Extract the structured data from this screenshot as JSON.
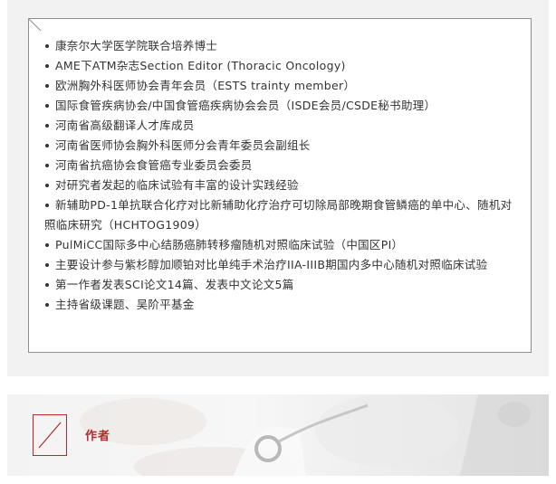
{
  "bio": {
    "items": [
      "康奈尔大学医学院联合培养博士",
      "AME下ATM杂志Section Editor (Thoracic Oncology)",
      "欧洲胸外科医师协会青年会员（ESTS trainty member）",
      "国际食管疾病协会/中国食管癌疾病协会会员（ISDE会员/CSDE秘书助理）",
      "河南省高级翻译人才库成员",
      "河南省医师协会胸外科医师分会青年委员会副组长",
      "河南省抗癌协会食管癌专业委员会委员",
      "对研究者发起的临床试验有丰富的设计实践经验",
      "新辅助PD-1单抗联合化疗对比新辅助化疗治疗可切除局部晚期食管鳞癌的单中心、随机对照临床研究（HCHTOG1909）",
      "PulMiCC国际多中心结肠癌肺转移瘤随机对照临床试验（中国区PI）",
      "主要设计参与紫杉醇加顺铂对比单纯手术治疗IIA-IIIB期国内多中心随机对照临床试验",
      "第一作者发表SCI论文14篇、发表中文论文5篇",
      "主持省级课题、吴阶平基金"
    ]
  },
  "author_section": {
    "title": "作者"
  },
  "colors": {
    "accent": "#b22a2a",
    "text": "#333333",
    "panel": "#f2f2f2",
    "card_border": "#8f8f8f"
  }
}
